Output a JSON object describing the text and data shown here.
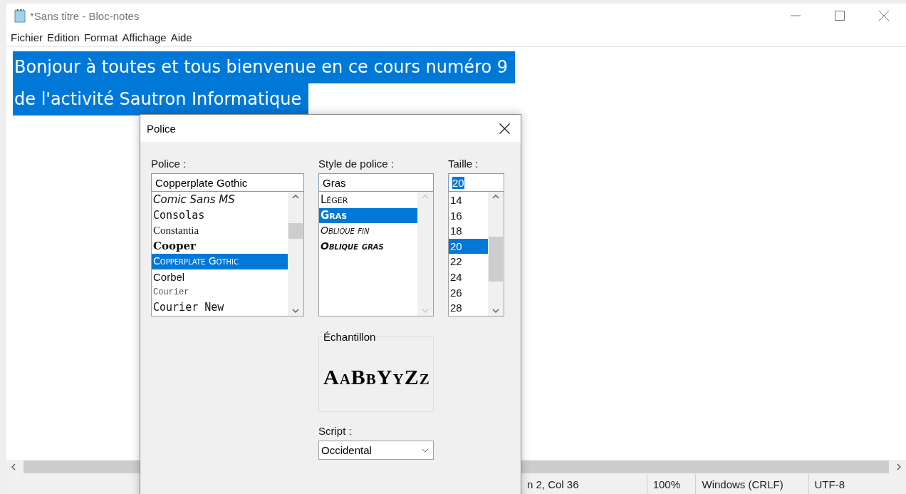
{
  "window": {
    "title": "*Sans titre - Bloc-notes"
  },
  "menu": [
    "Fichier",
    "Edition",
    "Format",
    "Affichage",
    "Aide"
  ],
  "editor": {
    "lines": [
      "Bonjour à toutes et tous bienvenue en ce cours numéro 9 ",
      "de l'activité Sautron Informatique "
    ]
  },
  "dialog": {
    "title": "Police",
    "font": {
      "label": "Police :",
      "value": "Copperplate Gothic",
      "items": [
        {
          "label": "Comic Sans MS",
          "kind": "script",
          "selected": false
        },
        {
          "label": "Consolas",
          "kind": "mono",
          "selected": false
        },
        {
          "label": "Constantia",
          "kind": "serif",
          "selected": false
        },
        {
          "label": "Cooper",
          "kind": "heavy",
          "selected": false
        },
        {
          "label": "Copperplate Gothic",
          "kind": "caps",
          "selected": true
        },
        {
          "label": "Corbel",
          "kind": "sans",
          "selected": false
        },
        {
          "label": "Courier",
          "kind": "smallmono",
          "selected": false
        },
        {
          "label": "Courier New",
          "kind": "mono",
          "selected": false
        }
      ]
    },
    "style": {
      "label": "Style de police :",
      "value": "Gras",
      "items": [
        {
          "label": "Léger",
          "kind": "regular",
          "selected": false
        },
        {
          "label": "Gras",
          "kind": "bold",
          "selected": true
        },
        {
          "label": "Oblique fin",
          "kind": "italic",
          "selected": false
        },
        {
          "label": "Oblique gras",
          "kind": "bolditalic",
          "selected": false
        }
      ]
    },
    "size": {
      "label": "Taille :",
      "value": "20",
      "items": [
        {
          "label": "14",
          "selected": false
        },
        {
          "label": "16",
          "selected": false
        },
        {
          "label": "18",
          "selected": false
        },
        {
          "label": "20",
          "selected": true
        },
        {
          "label": "22",
          "selected": false
        },
        {
          "label": "24",
          "selected": false
        },
        {
          "label": "26",
          "selected": false
        },
        {
          "label": "28",
          "selected": false
        }
      ]
    },
    "sample": {
      "label": "Échantillon",
      "text": "AaBbYyZz"
    },
    "script": {
      "label": "Script :",
      "value": "Occidental"
    }
  },
  "status_bar": [
    "n 2, Col 36",
    "100%",
    "Windows (CRLF)",
    "UTF-8"
  ]
}
